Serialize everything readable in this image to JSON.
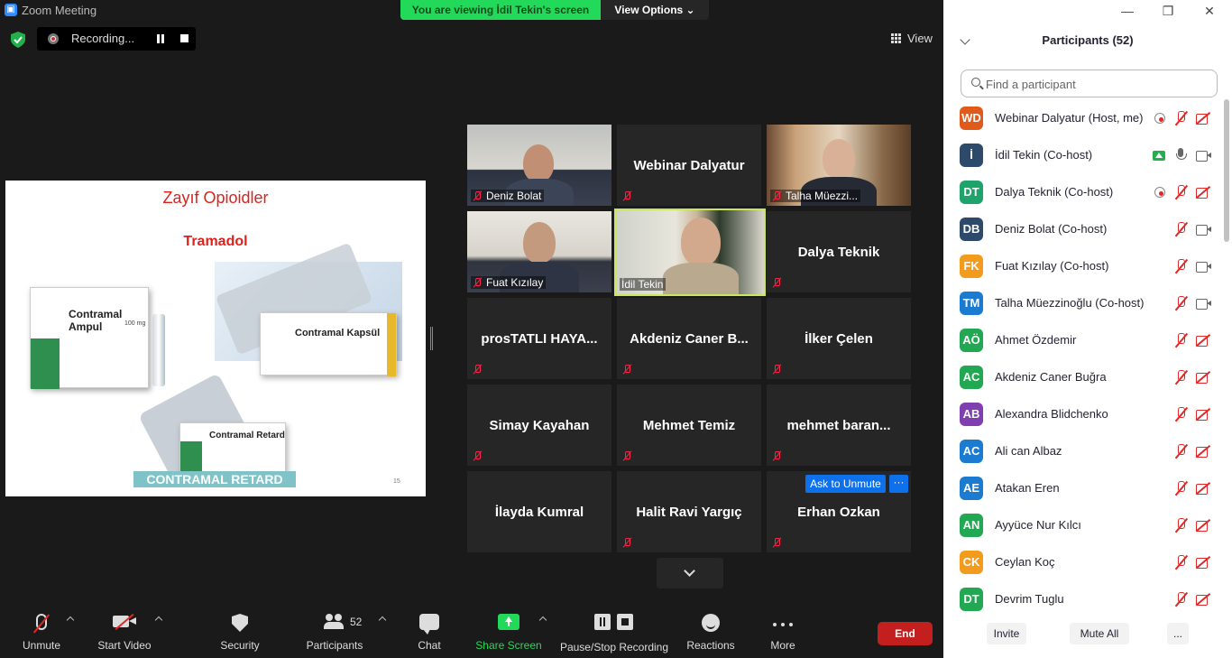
{
  "window": {
    "title": "Zoom Meeting"
  },
  "banner": {
    "viewing": "You are viewing İdil Tekin's screen",
    "view_options": "View Options ⌄"
  },
  "recording": {
    "label": "Recording..."
  },
  "view_button": {
    "label": "View"
  },
  "slide": {
    "title": "Zayıf Opioidler",
    "subtitle": "Tramadol",
    "box_ampul": "Contramal Ampul",
    "box_ampul_dose": "100 mg",
    "box_kapsul": "Contramal Kapsül",
    "box_retard": "Contramal Retard",
    "caption": "CONTRAMAL RETARD",
    "page_number": "15"
  },
  "gallery": {
    "tiles": [
      {
        "name": "Deniz Bolat",
        "type": "video"
      },
      {
        "name": "Webinar Dalyatur",
        "type": "name"
      },
      {
        "name": "Talha Müezzi...",
        "type": "video"
      },
      {
        "name": "Fuat Kızılay",
        "type": "video"
      },
      {
        "name": "İdil Tekin",
        "type": "video"
      },
      {
        "name": "Dalya Teknik",
        "type": "name"
      },
      {
        "name": "prosTATLI HAYA...",
        "type": "name"
      },
      {
        "name": "Akdeniz Caner B...",
        "type": "name"
      },
      {
        "name": "İlker Çelen",
        "type": "name"
      },
      {
        "name": "Simay Kayahan",
        "type": "name"
      },
      {
        "name": "Mehmet Temiz",
        "type": "name"
      },
      {
        "name": "mehmet baran...",
        "type": "name"
      },
      {
        "name": "İlayda Kumral",
        "type": "name"
      },
      {
        "name": "Halit Ravi Yargıç",
        "type": "name"
      },
      {
        "name": "Erhan Ozkan",
        "type": "name"
      }
    ],
    "ask_to_unmute": "Ask to Unmute",
    "more": "···"
  },
  "toolbar": {
    "unmute": "Unmute",
    "start_video": "Start Video",
    "security": "Security",
    "participants": "Participants",
    "participants_count": "52",
    "chat": "Chat",
    "share_screen": "Share Screen",
    "pause_stop_recording": "Pause/Stop Recording",
    "reactions": "Reactions",
    "more": "More",
    "end": "End"
  },
  "panel": {
    "minimize": "—",
    "restore": "❐",
    "close": "✕",
    "title": "Participants (52)",
    "search_placeholder": "Find a participant",
    "participants": [
      {
        "initials": "WD",
        "name": "Webinar Dalyatur (Host, me)",
        "color": "#e05a1b",
        "rec": true,
        "share": false,
        "mic": "muted",
        "cam": "muted"
      },
      {
        "initials": "İ",
        "name": "İdil Tekin (Co-host)",
        "color": "#2d4a6b",
        "rec": false,
        "share": true,
        "mic": "on",
        "cam": "on"
      },
      {
        "initials": "DT",
        "name": "Dalya Teknik (Co-host)",
        "color": "#1ea36b",
        "rec": true,
        "share": false,
        "mic": "muted",
        "cam": "muted"
      },
      {
        "initials": "DB",
        "name": "Deniz Bolat (Co-host)",
        "color": "#2d4a6b",
        "rec": false,
        "share": false,
        "mic": "muted",
        "cam": "on"
      },
      {
        "initials": "FK",
        "name": "Fuat Kızılay (Co-host)",
        "color": "#f29b1d",
        "rec": false,
        "share": false,
        "mic": "muted",
        "cam": "on"
      },
      {
        "initials": "TM",
        "name": "Talha Müezzinoğlu (Co-host)",
        "color": "#1a7bd0",
        "rec": false,
        "share": false,
        "mic": "muted",
        "cam": "on"
      },
      {
        "initials": "AÖ",
        "name": "Ahmet Özdemir",
        "color": "#22a852",
        "rec": false,
        "share": false,
        "mic": "muted",
        "cam": "muted"
      },
      {
        "initials": "AC",
        "name": "Akdeniz Caner Buğra",
        "color": "#22a852",
        "rec": false,
        "share": false,
        "mic": "muted",
        "cam": "muted"
      },
      {
        "initials": "AB",
        "name": "Alexandra Blidchenko",
        "color": "#7f3fb0",
        "rec": false,
        "share": false,
        "mic": "muted",
        "cam": "muted"
      },
      {
        "initials": "AC",
        "name": "Ali can Albaz",
        "color": "#1a7bd0",
        "rec": false,
        "share": false,
        "mic": "muted",
        "cam": "muted"
      },
      {
        "initials": "AE",
        "name": "Atakan Eren",
        "color": "#1a7bd0",
        "rec": false,
        "share": false,
        "mic": "muted",
        "cam": "muted"
      },
      {
        "initials": "AN",
        "name": "Ayyüce Nur Kılcı",
        "color": "#22a852",
        "rec": false,
        "share": false,
        "mic": "muted",
        "cam": "muted"
      },
      {
        "initials": "CK",
        "name": "Ceylan Koç",
        "color": "#f29b1d",
        "rec": false,
        "share": false,
        "mic": "muted",
        "cam": "muted"
      },
      {
        "initials": "DT",
        "name": "Devrim Tuglu",
        "color": "#22a852",
        "rec": false,
        "share": false,
        "mic": "muted",
        "cam": "muted"
      }
    ],
    "invite": "Invite",
    "mute_all": "Mute All",
    "more": "..."
  }
}
